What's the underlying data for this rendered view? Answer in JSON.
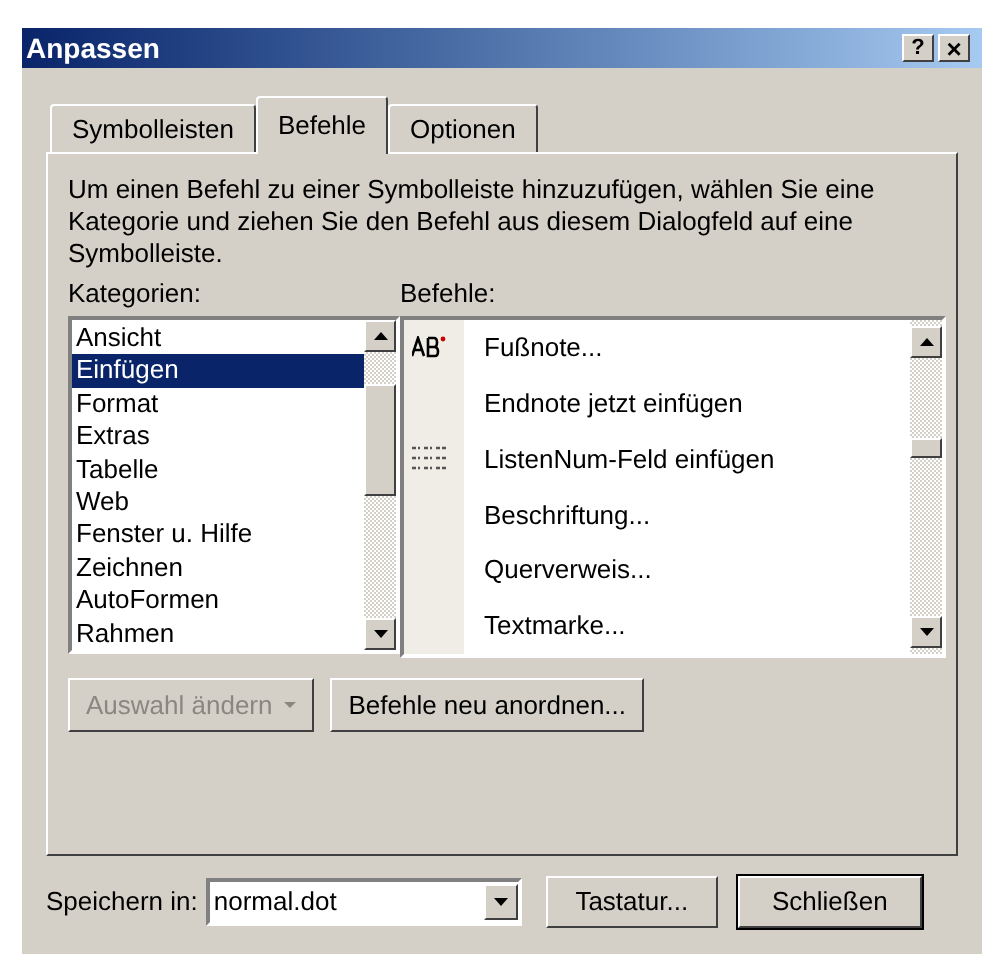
{
  "window": {
    "title": "Anpassen",
    "help_button": "?",
    "close_button": "×"
  },
  "tabs": [
    {
      "label": "Symbolleisten",
      "selected": false
    },
    {
      "label": "Befehle",
      "selected": true
    },
    {
      "label": "Optionen",
      "selected": false
    }
  ],
  "description": "Um einen Befehl zu einer Symbolleiste hinzuzufügen, wählen Sie eine Kategorie und ziehen Sie den Befehl aus diesem Dialogfeld auf eine Symbolleiste.",
  "categories": {
    "label": "Kategorien:",
    "items": [
      {
        "label": "Ansicht",
        "selected": false
      },
      {
        "label": "Einfügen",
        "selected": true
      },
      {
        "label": "Format",
        "selected": false
      },
      {
        "label": "Extras",
        "selected": false
      },
      {
        "label": "Tabelle",
        "selected": false
      },
      {
        "label": "Web",
        "selected": false
      },
      {
        "label": "Fenster u. Hilfe",
        "selected": false
      },
      {
        "label": "Zeichnen",
        "selected": false
      },
      {
        "label": "AutoFormen",
        "selected": false
      },
      {
        "label": "Rahmen",
        "selected": false
      }
    ]
  },
  "commands": {
    "label": "Befehle:",
    "items": [
      {
        "label": "Fußnote...",
        "kind": "footnote"
      },
      {
        "label": "Endnote jetzt einfügen",
        "kind": "plain"
      },
      {
        "label": "ListenNum-Feld einfügen",
        "kind": "listnum"
      },
      {
        "label": "Beschriftung...",
        "kind": "plain"
      },
      {
        "label": "Querverweis...",
        "kind": "plain"
      },
      {
        "label": "Textmarke...",
        "kind": "plain"
      }
    ]
  },
  "buttons": [
    {
      "label": "Auswahl ändern",
      "disabled": true,
      "dropdown": true
    },
    {
      "label": "Befehle neu anordnen...",
      "disabled": false,
      "dropdown": false
    }
  ],
  "save_in": {
    "label": "Speichern in:",
    "value": "normal.dot"
  },
  "footer_buttons": [
    "Tastatur...",
    "Schließen"
  ]
}
